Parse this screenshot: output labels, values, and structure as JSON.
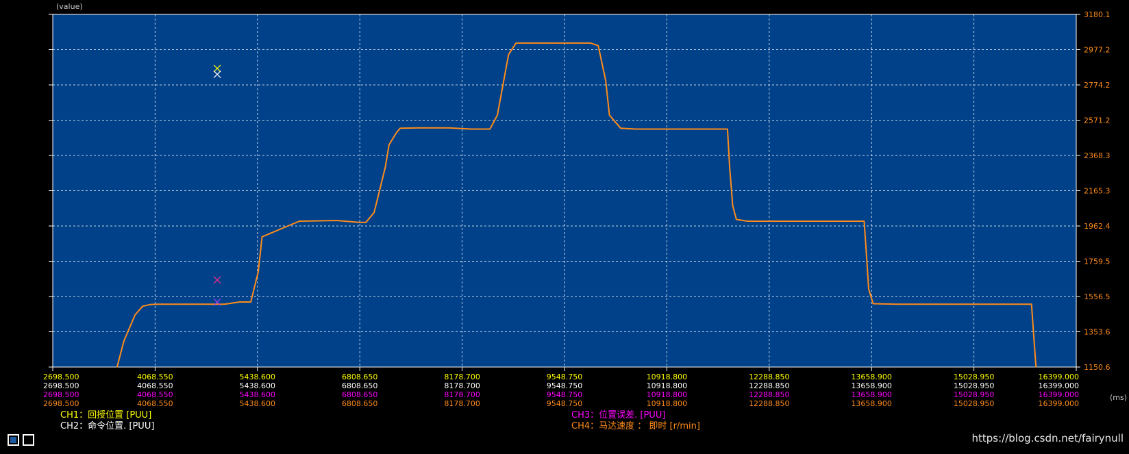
{
  "chart_data": {
    "type": "line",
    "title": "",
    "ylabel": "(value)",
    "xlabel": "(ms)",
    "ylim": [
      1150.6,
      3180.1
    ],
    "xlim": [
      2698.5,
      16399.0
    ],
    "y_tick_labels": [
      "1150.6",
      "1353.6",
      "1556.5",
      "1759.5",
      "1962.4",
      "2165.3",
      "2368.3",
      "2571.2",
      "2774.2",
      "2977.2",
      "3180.1"
    ],
    "x_tick_rows": [
      {
        "channel": "CH1",
        "color": "#ffff00",
        "labels": [
          "2698.500",
          "4068.550",
          "5438.600",
          "6808.650",
          "8178.700",
          "9548.750",
          "10918.800",
          "12288.850",
          "13658.900",
          "15028.950",
          "16399.000"
        ]
      },
      {
        "channel": "CH2",
        "color": "#ffffff",
        "labels": [
          "2698.500",
          "4068.550",
          "5438.600",
          "6808.650",
          "8178.700",
          "9548.750",
          "10918.800",
          "12288.850",
          "13658.900",
          "15028.950",
          "16399.000"
        ]
      },
      {
        "channel": "CH3",
        "color": "#ff00ff",
        "labels": [
          "2698.500",
          "4068.550",
          "5438.600",
          "6808.650",
          "8178.700",
          "9548.750",
          "10918.800",
          "12288.850",
          "13658.900",
          "15028.950",
          "16399.000"
        ]
      },
      {
        "channel": "CH4",
        "color": "#ff8c1a",
        "labels": [
          "2698.500",
          "4068.550",
          "5438.600",
          "6808.650",
          "8178.700",
          "9548.750",
          "10918.800",
          "12288.850",
          "13658.900",
          "15028.950",
          "16399.000"
        ]
      }
    ],
    "grid": true,
    "series": [
      {
        "name": "CH4：马达速度 ： 即时 [r/min]",
        "color": "#ff8c1a",
        "x": [
          3560,
          3650,
          3800,
          3900,
          4000,
          4100,
          4200,
          4300,
          4400,
          4500,
          5000,
          5200,
          5300,
          5350,
          5450,
          5500,
          6000,
          6500,
          6800,
          6890,
          7000,
          7150,
          7200,
          7300,
          7350,
          7600,
          8000,
          8300,
          8550,
          8650,
          8800,
          8900,
          9400,
          9900,
          10000,
          10100,
          10150,
          10300,
          10500,
          11000,
          11500,
          11730,
          11760,
          11800,
          11850,
          12000,
          13000,
          13560,
          13590,
          13620,
          13680,
          14000,
          15000,
          15800,
          15835,
          15860
        ],
        "values": [
          1150.6,
          1300,
          1450,
          1500,
          1510,
          1512,
          1512,
          1512,
          1512,
          1512,
          1512,
          1525,
          1525,
          1525,
          1700,
          1900,
          1990,
          1994,
          1983,
          1983,
          2040,
          2300,
          2430,
          2500,
          2525,
          2527,
          2527,
          2520,
          2520,
          2600,
          2950,
          3015,
          3015,
          3015,
          3000,
          2800,
          2600,
          2525,
          2520,
          2520,
          2520,
          2520,
          2300,
          2080,
          2000,
          1990,
          1990,
          1990,
          1800,
          1600,
          1515,
          1512,
          1512,
          1512,
          1300,
          1150.6
        ]
      }
    ],
    "markers": [
      {
        "label": "CH1",
        "color": "#ffff00",
        "x": 4900,
        "y": 2869
      },
      {
        "label": "CH2",
        "color": "#ffffff",
        "x": 4900,
        "y": 2835
      },
      {
        "label": "CH3",
        "color": "#ff2a8a",
        "x": 4900,
        "y": 1652
      },
      {
        "label": "CH4",
        "color": "#b040ff",
        "x": 4900,
        "y": 1524
      }
    ]
  },
  "legend": {
    "ch1": "CH1：回授位置 [PUU]",
    "ch2": "CH2：命令位置. [PUU]",
    "ch3": "CH3：位置误差. [PUU]",
    "ch4": "CH4：马达速度 ： 即时 [r/min]"
  },
  "watermark": "https://blog.csdn.net/fairynull",
  "colors": {
    "plot_bg": "#00418a",
    "grid": "#c8d4e4",
    "axis_text": "#ff8c1a"
  }
}
